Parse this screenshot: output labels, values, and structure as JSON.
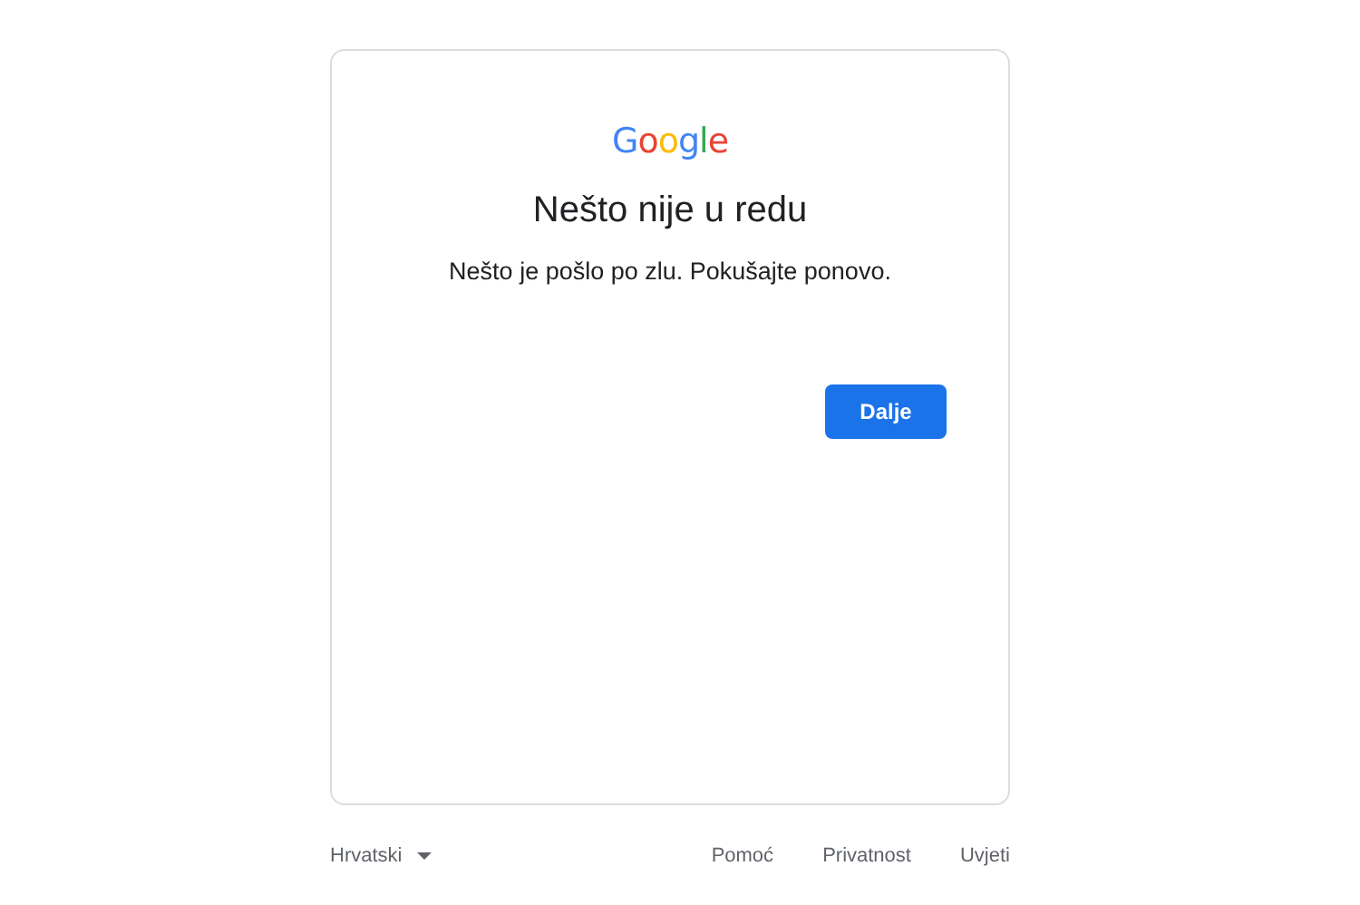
{
  "logo": [
    {
      "letter": "G",
      "color": "#4285f4"
    },
    {
      "letter": "o",
      "color": "#ea4335"
    },
    {
      "letter": "o",
      "color": "#fbbc05"
    },
    {
      "letter": "g",
      "color": "#4285f4"
    },
    {
      "letter": "l",
      "color": "#34a853"
    },
    {
      "letter": "e",
      "color": "#ea4335"
    }
  ],
  "heading": "Nešto nije u redu",
  "message": "Nešto je pošlo po zlu. Pokušajte ponovo.",
  "button": "Dalje",
  "footer": {
    "language": "Hrvatski",
    "links": [
      "Pomoć",
      "Privatnost",
      "Uvjeti"
    ]
  }
}
